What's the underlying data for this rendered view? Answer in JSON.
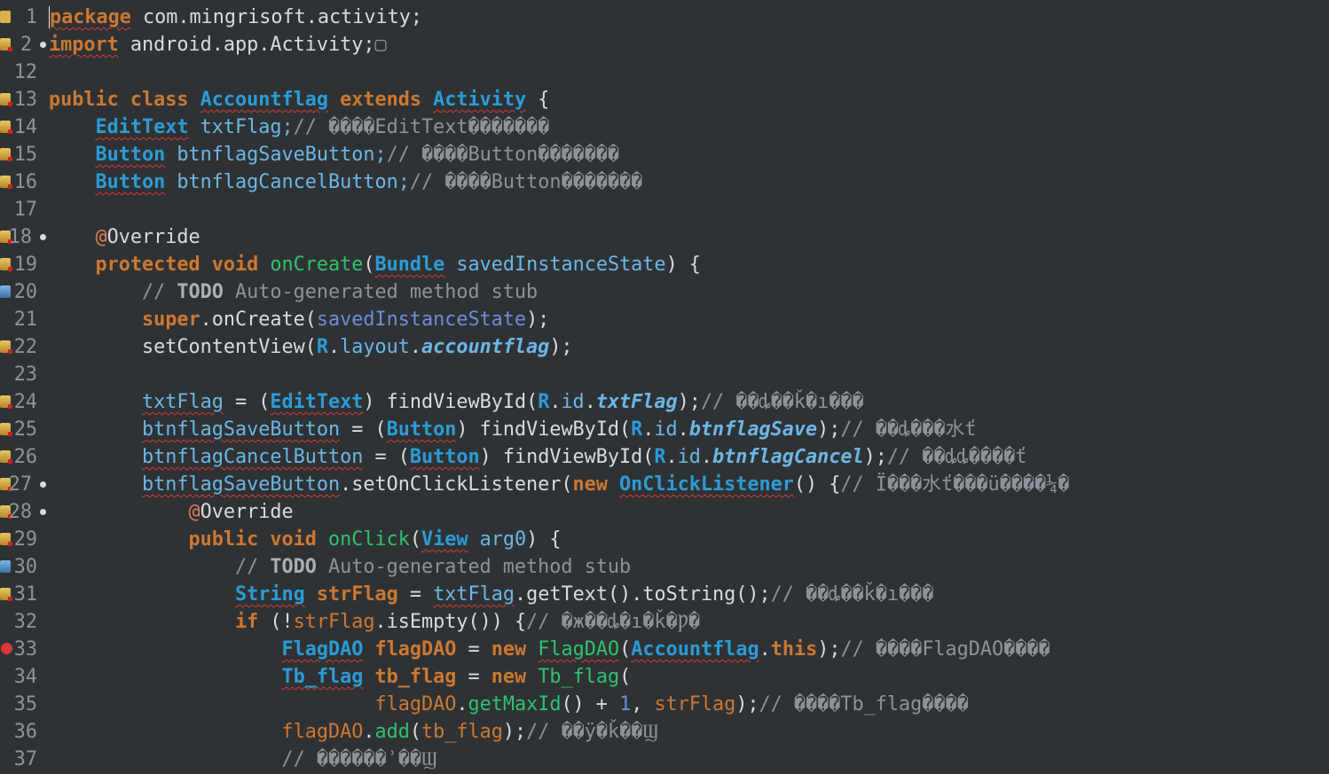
{
  "editor": {
    "line_numbers": [
      "1",
      "2",
      "12",
      "13",
      "14",
      "15",
      "16",
      "17",
      "18",
      "19",
      "20",
      "21",
      "22",
      "23",
      "24",
      "25",
      "26",
      "27",
      "28",
      "29",
      "30",
      "31",
      "32",
      "33",
      "34",
      "35",
      "36",
      "37"
    ],
    "code": {
      "l1": {
        "kw": "package",
        "rest": " com.mingrisoft.activity;"
      },
      "l2": {
        "kw": "import",
        "rest": " android.app.Activity;",
        "fold": "▢"
      },
      "l13": {
        "kw1": "public",
        "kw2": "class",
        "cls": "Accountflag",
        "kw3": "extends",
        "sup": "Activity",
        "brace": " {"
      },
      "l14": {
        "type": "EditText",
        "var": " txtFlag;",
        "comment": "// ����EditText�������"
      },
      "l15": {
        "type": "Button",
        "var": " btnflagSaveButton;",
        "comment": "// ����Button�������"
      },
      "l16": {
        "type": "Button",
        "var": " btnflagCancelButton;",
        "comment": "// ����Button�������"
      },
      "l18": {
        "at": "@",
        "ann": "Override"
      },
      "l19": {
        "kw1": "protected",
        "kw2": "void",
        "meth": "onCreate",
        "p1": "(",
        "type": "Bundle",
        "param": "savedInstanceState",
        "p2": ") {"
      },
      "l20": {
        "c1": "// ",
        "todo": "TODO",
        "c2": " Auto-generated method stub"
      },
      "l21": {
        "kw": "super",
        "rest1": ".onCreate(",
        "param": "savedInstanceState",
        "rest2": ");"
      },
      "l22": {
        "rest1": "setContentView(",
        "r": "R",
        "dot1": ".",
        "layout": "layout",
        "dot2": ".",
        "res": "accountflag",
        "rest2": ");"
      },
      "l24": {
        "var": "txtFlag",
        "eq": " = (",
        "type": "EditText",
        "mid": ") findViewById(",
        "r": "R",
        "dot1": ".",
        "id": "id",
        "dot2": ".",
        "res": "txtFlag",
        "end": ");",
        "comment": "// ��ȡ��ǩ�ı���"
      },
      "l25": {
        "var": "btnflagSaveButton",
        "eq": " = (",
        "type": "Button",
        "mid": ") findViewById(",
        "r": "R",
        "dot1": ".",
        "id": "id",
        "dot2": ".",
        "res": "btnflagSave",
        "end": ");",
        "comment": "// ��ȡ���水ť"
      },
      "l26": {
        "var": "btnflagCancelButton",
        "eq": " = (",
        "type": "Button",
        "mid": ") findViewById(",
        "r": "R",
        "dot1": ".",
        "id": "id",
        "dot2": ".",
        "res": "btnflagCancel",
        "end": ");",
        "comment": "// ��ȡȡ����ť"
      },
      "l27": {
        "var": "btnflagSaveButton",
        "mid": ".setOnClickListener(",
        "kw": "new",
        "type": "OnClickListener",
        "end": "() {",
        "comment": "// Ϊ���水ť���ü����¼�"
      },
      "l28": {
        "at": "@",
        "ann": "Override"
      },
      "l29": {
        "kw1": "public",
        "kw2": "void",
        "meth": "onClick",
        "p1": "(",
        "type": "View",
        "param": "arg0",
        "p2": ") {"
      },
      "l30": {
        "c1": "// ",
        "todo": "TODO",
        "c2": " Auto-generated method stub"
      },
      "l31": {
        "type": "String",
        "var": "strFlag",
        "eq": " = ",
        "fld": "txtFlag",
        "rest": ".getText().toString();",
        "comment": "// ��ȡ��ǩ�ı���"
      },
      "l32": {
        "kw": "if",
        "p1": " (!",
        "fld": "strFlag",
        "rest": ".isEmpty()) {",
        "comment": "// �ж��ȡ�ı�ǩ�Ƿ�"
      },
      "l33": {
        "type": "FlagDAO",
        "var": "flagDAO",
        "eq": " = ",
        "kw": "new",
        "ctor": "FlagDAO",
        "p1": "(",
        "cls": "Accountflag",
        "dot": ".",
        "kw2": "this",
        "end": ");",
        "comment": "// ����FlagDAO����"
      },
      "l34": {
        "type": "Tb_flag",
        "var": "tb_flag",
        "eq": " = ",
        "kw": "new",
        "ctor": "Tb_flag",
        "end": "("
      },
      "l35": {
        "fld": "flagDAO",
        "dot": ".",
        "meth": "getMaxId",
        "rest": "() + ",
        "num": "1",
        "comma": ", ",
        "fld2": "strFlag",
        "end": ");",
        "comment": "// ����Tb_flag����"
      },
      "l36": {
        "fld": "flagDAO",
        "dot": ".",
        "meth": "add",
        "p1": "(",
        "fld2": "tb_flag",
        "end": ");",
        "comment": "// ��ӱ�ǩ��Ϣ"
      },
      "l37": {
        "comment": "// ������ʾ��Ϣ"
      }
    }
  }
}
